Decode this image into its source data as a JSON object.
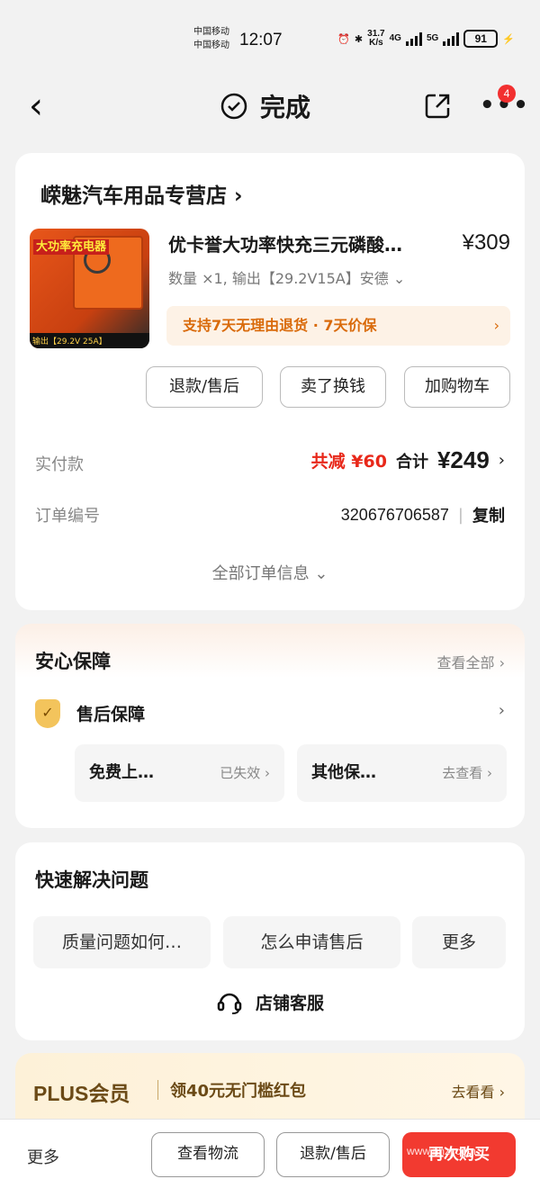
{
  "status_bar": {
    "carrier1": "中国移动",
    "carrier2": "中国移动",
    "time": "12:07",
    "speed_value": "31.7",
    "speed_unit": "K/s",
    "net1": "4G",
    "net2": "5G",
    "battery": "91"
  },
  "header": {
    "title": "完成",
    "badge_count": "4"
  },
  "order": {
    "shop_name": "嵘魅汽车用品专营店",
    "product": {
      "title": "优卡誉大功率快充三元磷酸…",
      "price": "¥309",
      "spec": "数量 ×1, 输出【29.2V15A】安德",
      "thumb_text": "大功率充电器",
      "thumb_caption": "输出【29.2V 25A】"
    },
    "promise": "支持7天无理由退货 · 7天价保",
    "buttons": {
      "refund": "退款/售后",
      "sell": "卖了换钱",
      "cart": "加购物车"
    },
    "paid": {
      "label": "实付款",
      "discount": "共减 ¥60",
      "total_label": "合计",
      "total": "¥249"
    },
    "order_no": {
      "label": "订单编号",
      "value": "320676706587",
      "copy": "复制"
    },
    "all_info": "全部订单信息"
  },
  "guarantee": {
    "title": "安心保障",
    "see_all": "查看全部",
    "after_sales": "售后保障",
    "tiles": [
      {
        "label": "免费上…",
        "status": "已失效"
      },
      {
        "label": "其他保…",
        "status": "去查看"
      }
    ]
  },
  "quick": {
    "title": "快速解决问题",
    "chips": [
      "质量问题如何…",
      "怎么申请售后",
      "更多"
    ],
    "service": "店铺客服"
  },
  "plus": {
    "brand": "PLUS会员",
    "text": "领40元无门槛红包",
    "link": "去看看"
  },
  "bottom": {
    "more": "更多",
    "logistics": "查看物流",
    "refund": "退款/售后",
    "rebuy": "再次购买",
    "watermark": "www.nhzj.com"
  },
  "colors": {
    "accent": "#f23a30",
    "promise": "#d96a0a",
    "plus_gold": "#6b4a16"
  }
}
